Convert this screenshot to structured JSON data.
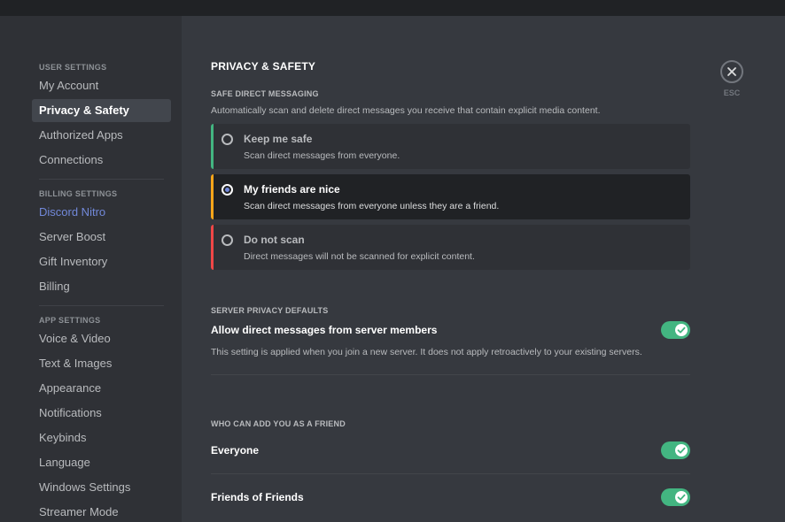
{
  "sidebar": {
    "sections": [
      {
        "header": "USER SETTINGS",
        "items": [
          {
            "label": "My Account"
          },
          {
            "label": "Privacy & Safety",
            "selected": true
          },
          {
            "label": "Authorized Apps"
          },
          {
            "label": "Connections"
          }
        ]
      },
      {
        "header": "BILLING SETTINGS",
        "items": [
          {
            "label": "Discord Nitro"
          },
          {
            "label": "Server Boost"
          },
          {
            "label": "Gift Inventory"
          },
          {
            "label": "Billing"
          }
        ]
      },
      {
        "header": "APP SETTINGS",
        "items": [
          {
            "label": "Voice & Video"
          },
          {
            "label": "Text & Images"
          },
          {
            "label": "Appearance"
          },
          {
            "label": "Notifications"
          },
          {
            "label": "Keybinds"
          },
          {
            "label": "Language"
          },
          {
            "label": "Windows Settings"
          },
          {
            "label": "Streamer Mode"
          }
        ]
      }
    ]
  },
  "main": {
    "title": "PRIVACY & SAFETY",
    "safe_dm": {
      "label": "SAFE DIRECT MESSAGING",
      "description": "Automatically scan and delete direct messages you receive that contain explicit media content.",
      "options": [
        {
          "title": "Keep me safe",
          "description": "Scan direct messages from everyone.",
          "color": "#43b581",
          "selected": false
        },
        {
          "title": "My friends are nice",
          "description": "Scan direct messages from everyone unless they are a friend.",
          "color": "#faa61a",
          "selected": true
        },
        {
          "title": "Do not scan",
          "description": "Direct messages will not be scanned for explicit content.",
          "color": "#f04747",
          "selected": false
        }
      ]
    },
    "server_privacy": {
      "label": "SERVER PRIVACY DEFAULTS",
      "toggle_title": "Allow direct messages from server members",
      "toggle_on": true,
      "description": "This setting is applied when you join a new server. It does not apply retroactively to your existing servers."
    },
    "friend_requests": {
      "label": "WHO CAN ADD YOU AS A FRIEND",
      "items": [
        {
          "title": "Everyone",
          "on": true
        },
        {
          "title": "Friends of Friends",
          "on": true
        }
      ]
    }
  },
  "close": {
    "label": "ESC",
    "icon": "close-icon"
  },
  "colors": {
    "accent": "#7289da",
    "toggle_on": "#43b581",
    "background": "#36393f",
    "sidebar": "#2f3136"
  }
}
